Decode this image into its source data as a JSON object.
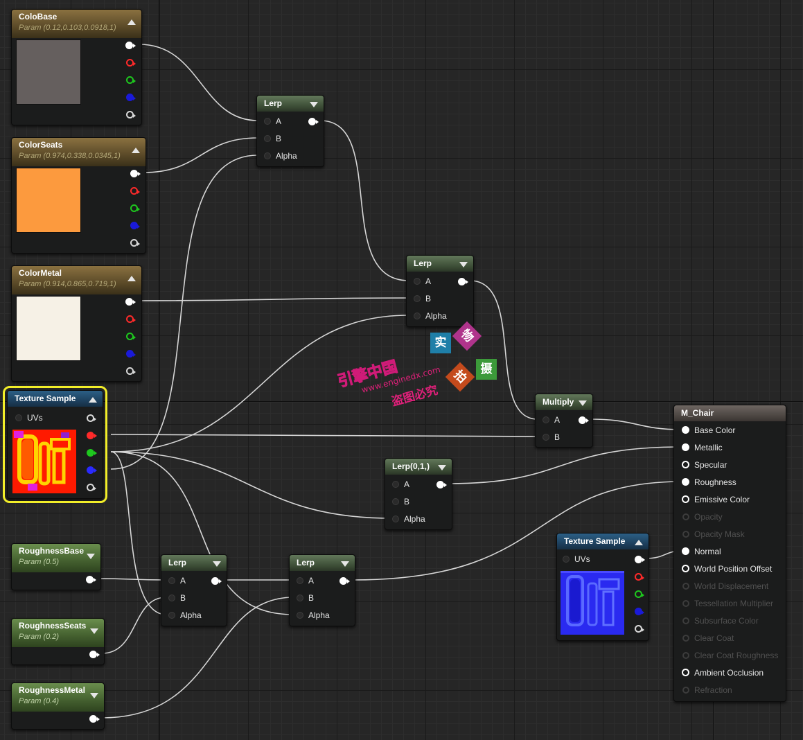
{
  "nodes": {
    "colobase": {
      "title": "ColoBase",
      "subtitle": "Param (0.12,0.103,0.0918,1)",
      "color": "#655f5e"
    },
    "colorseats": {
      "title": "ColorSeats",
      "subtitle": "Param (0.974,0.338,0.0345,1)",
      "color": "#fc9a3e"
    },
    "colormetal": {
      "title": "ColorMetal",
      "subtitle": "Param (0.914,0.865,0.719,1)",
      "color": "#f6f1e6"
    },
    "texsample1": {
      "title": "Texture Sample",
      "uvs": "UVs"
    },
    "lerp1": {
      "title": "Lerp",
      "a": "A",
      "b": "B",
      "alpha": "Alpha"
    },
    "lerp2": {
      "title": "Lerp",
      "a": "A",
      "b": "B",
      "alpha": "Alpha"
    },
    "multiply": {
      "title": "Multiply",
      "a": "A",
      "b": "B"
    },
    "lerp01": {
      "title": "Lerp(0,1,)",
      "a": "A",
      "b": "B",
      "alpha": "Alpha"
    },
    "roughbase": {
      "title": "RoughnessBase",
      "subtitle": "Param (0.5)"
    },
    "roughseats": {
      "title": "RoughnessSeats",
      "subtitle": "Param (0.2)"
    },
    "roughmetal": {
      "title": "RoughnessMetal",
      "subtitle": "Param (0.4)"
    },
    "lerp3": {
      "title": "Lerp",
      "a": "A",
      "b": "B",
      "alpha": "Alpha"
    },
    "lerp4": {
      "title": "Lerp",
      "a": "A",
      "b": "B",
      "alpha": "Alpha"
    },
    "texsample2": {
      "title": "Texture Sample",
      "uvs": "UVs"
    },
    "material": {
      "title": "M_Chair",
      "pins": [
        {
          "label": "Base Color",
          "state": "filled"
        },
        {
          "label": "Metallic",
          "state": "filled"
        },
        {
          "label": "Specular",
          "state": "hollow"
        },
        {
          "label": "Roughness",
          "state": "filled"
        },
        {
          "label": "Emissive Color",
          "state": "hollow"
        },
        {
          "label": "Opacity",
          "state": "disabled"
        },
        {
          "label": "Opacity Mask",
          "state": "disabled"
        },
        {
          "label": "Normal",
          "state": "filled"
        },
        {
          "label": "World Position Offset",
          "state": "hollow"
        },
        {
          "label": "World Displacement",
          "state": "disabled"
        },
        {
          "label": "Tessellation Multiplier",
          "state": "disabled"
        },
        {
          "label": "Subsurface Color",
          "state": "disabled"
        },
        {
          "label": "Clear Coat",
          "state": "disabled"
        },
        {
          "label": "Clear Coat Roughness",
          "state": "disabled"
        },
        {
          "label": "Ambient Occlusion",
          "state": "hollow"
        },
        {
          "label": "Refraction",
          "state": "disabled"
        }
      ]
    }
  },
  "watermark": {
    "brand": "引擎中国",
    "url": "www.enginedx.com",
    "note": "盗图必究",
    "badges": [
      "实",
      "物",
      "拍",
      "摄"
    ]
  },
  "colors": {
    "param_header": "#7a6438",
    "lerp_header": "#4e6346",
    "texture_header": "#24506f",
    "roughness_header": "#587b3e",
    "material_header": "#5e5753",
    "selection": "#f2ee29",
    "wire": "#d6d6d6"
  }
}
